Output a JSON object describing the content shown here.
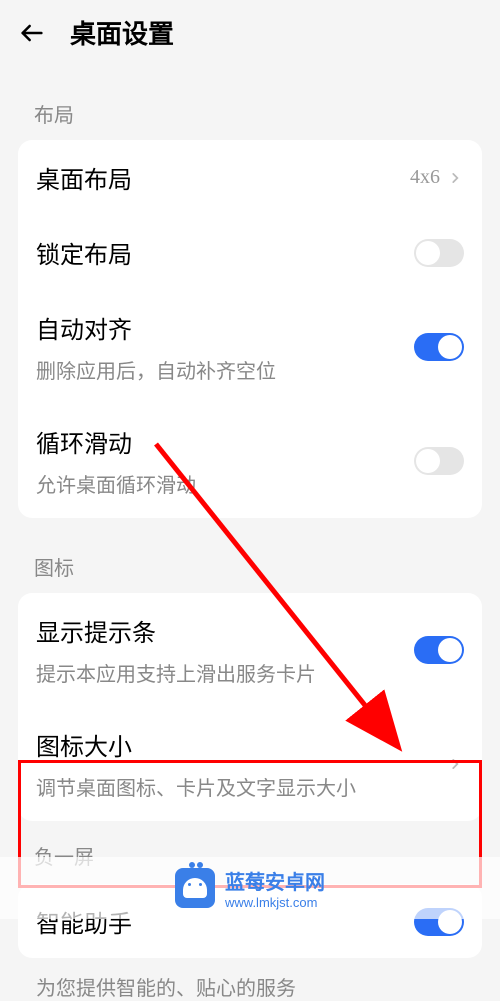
{
  "header": {
    "title": "桌面设置"
  },
  "sections": {
    "layout": {
      "label": "布局",
      "rows": {
        "desktop_layout": {
          "title": "桌面布局",
          "value": "4x6"
        },
        "lock_layout": {
          "title": "锁定布局",
          "switch": false
        },
        "auto_align": {
          "title": "自动对齐",
          "sub": "删除应用后，自动补齐空位",
          "switch": true
        },
        "loop_scroll": {
          "title": "循环滑动",
          "sub": "允许桌面循环滑动",
          "switch": false
        }
      }
    },
    "icons": {
      "label": "图标",
      "rows": {
        "show_tip": {
          "title": "显示提示条",
          "sub": "提示本应用支持上滑出服务卡片",
          "switch": true
        },
        "icon_size": {
          "title": "图标大小",
          "sub": "调节桌面图标、卡片及文字显示大小"
        }
      }
    },
    "minus_one": {
      "label": "负一屏",
      "rows": {
        "assistant": {
          "title": "智能助手",
          "switch": true
        }
      },
      "partial_sub": "为您提供智能的、贴心的服务"
    }
  },
  "watermark": {
    "title": "蓝莓安卓网",
    "url": "www.lmkjst.com"
  }
}
